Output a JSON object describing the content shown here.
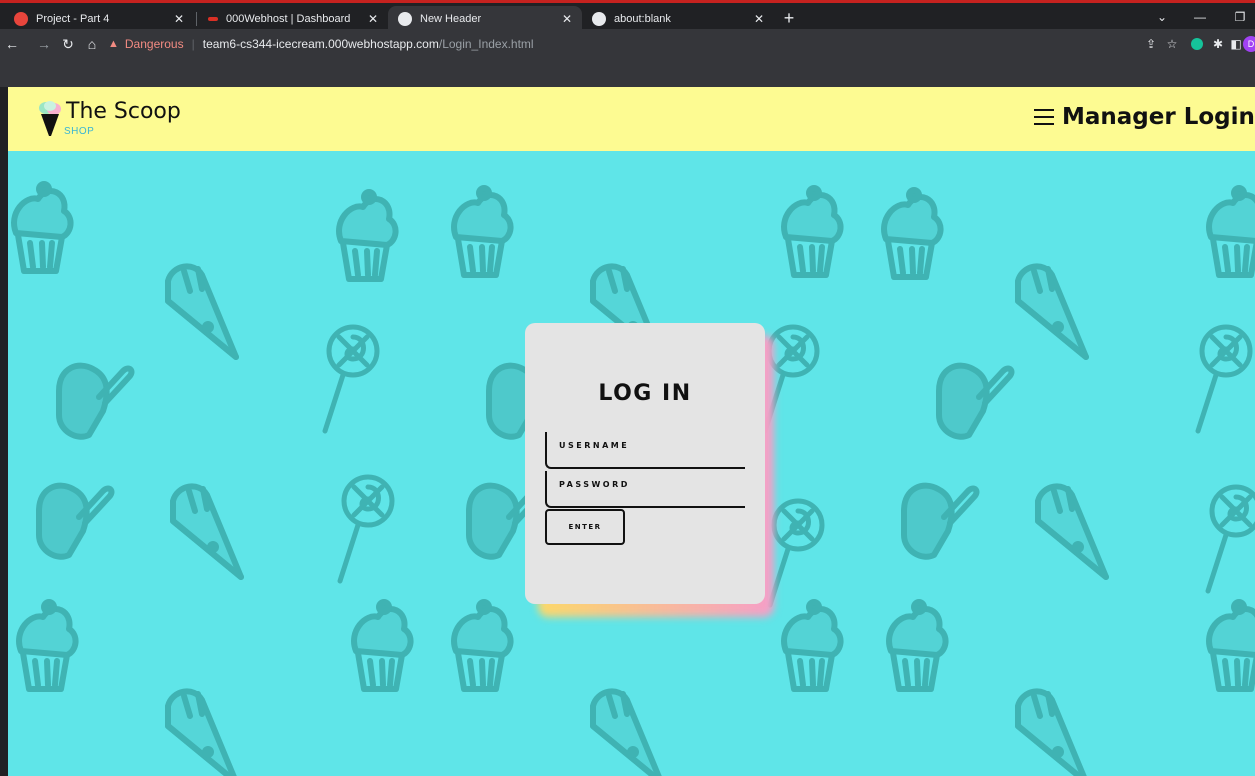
{
  "browser": {
    "tabs": [
      {
        "title": "Project - Part 4",
        "favicon_color": "#e8453c"
      },
      {
        "title": "000Webhost | Dashboard",
        "favicon_color": "#d93025"
      },
      {
        "title": "New Header",
        "favicon_color": "#e8eaed"
      },
      {
        "title": "about:blank",
        "favicon_color": "#e8eaed"
      }
    ],
    "active_tab": 2,
    "security_label": "Dangerous",
    "url_host": "team6-cs344-icecream.000webhostapp.com",
    "url_path": "/Login_Index.html",
    "profile_initial": "D"
  },
  "header": {
    "brand_name": "The Scoop",
    "brand_sub": "SHOP",
    "menu_title": "Manager Login",
    "background": "#fdfb92"
  },
  "login": {
    "title": "LOG IN",
    "username_placeholder": "USERNAME",
    "password_placeholder": "PASSWORD",
    "enter_label": "ENTER"
  },
  "colors": {
    "page_bg": "#5fe5e8",
    "pattern": "#3fb3b3",
    "card": "#e4e4e4"
  }
}
